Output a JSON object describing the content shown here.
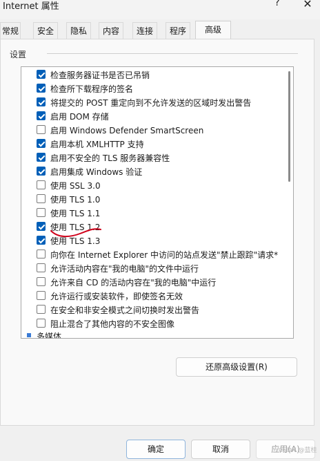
{
  "window": {
    "title": "Internet 属性",
    "help_label": "?",
    "close_label": "✕"
  },
  "tabs": [
    {
      "label": "常规",
      "active": false
    },
    {
      "label": "安全",
      "active": false
    },
    {
      "label": "隐私",
      "active": false
    },
    {
      "label": "内容",
      "active": false
    },
    {
      "label": "连接",
      "active": false
    },
    {
      "label": "程序",
      "active": false
    },
    {
      "label": "高级",
      "active": true
    }
  ],
  "settings": {
    "group_label": "设置",
    "items": [
      {
        "label": "检查服务器证书是否已吊销",
        "checked": true
      },
      {
        "label": "检查所下载程序的签名",
        "checked": true
      },
      {
        "label": "将提交的 POST 重定向到不允许发送的区域时发出警告",
        "checked": true
      },
      {
        "label": "启用 DOM 存储",
        "checked": true
      },
      {
        "label": "启用 Windows Defender SmartScreen",
        "checked": false
      },
      {
        "label": "启用本机 XMLHTTP 支持",
        "checked": true
      },
      {
        "label": "启用不安全的 TLS 服务器兼容性",
        "checked": true
      },
      {
        "label": "启用集成 Windows 验证",
        "checked": true
      },
      {
        "label": "使用 SSL 3.0",
        "checked": false
      },
      {
        "label": "使用 TLS 1.0",
        "checked": false
      },
      {
        "label": "使用 TLS 1.1",
        "checked": false
      },
      {
        "label": "使用 TLS 1.2",
        "checked": true
      },
      {
        "label": "使用 TLS 1.3",
        "checked": true
      },
      {
        "label": "向你在 Internet Explorer 中访问的站点发送\"禁止跟踪\"请求*",
        "checked": false
      },
      {
        "label": "允许活动内容在\"我的电脑\"的文件中运行",
        "checked": false
      },
      {
        "label": "允许来自 CD 的活动内容在\"我的电脑\"中运行",
        "checked": false
      },
      {
        "label": "允许运行或安装软件，即使签名无效",
        "checked": false
      },
      {
        "label": "在安全和非安全模式之间切换时发出警告",
        "checked": false
      },
      {
        "label": "阻止混合了其他内容的不安全图像",
        "checked": false
      }
    ],
    "tree_item": {
      "label": "多媒体"
    }
  },
  "buttons": {
    "restore": "还原高级设置(R)",
    "ok": "确定",
    "cancel": "取消",
    "apply": "应用(A)"
  },
  "watermark": "CSDN @蓝桂",
  "colors": {
    "accent": "#005fb8",
    "annotation": "#d0021b"
  }
}
